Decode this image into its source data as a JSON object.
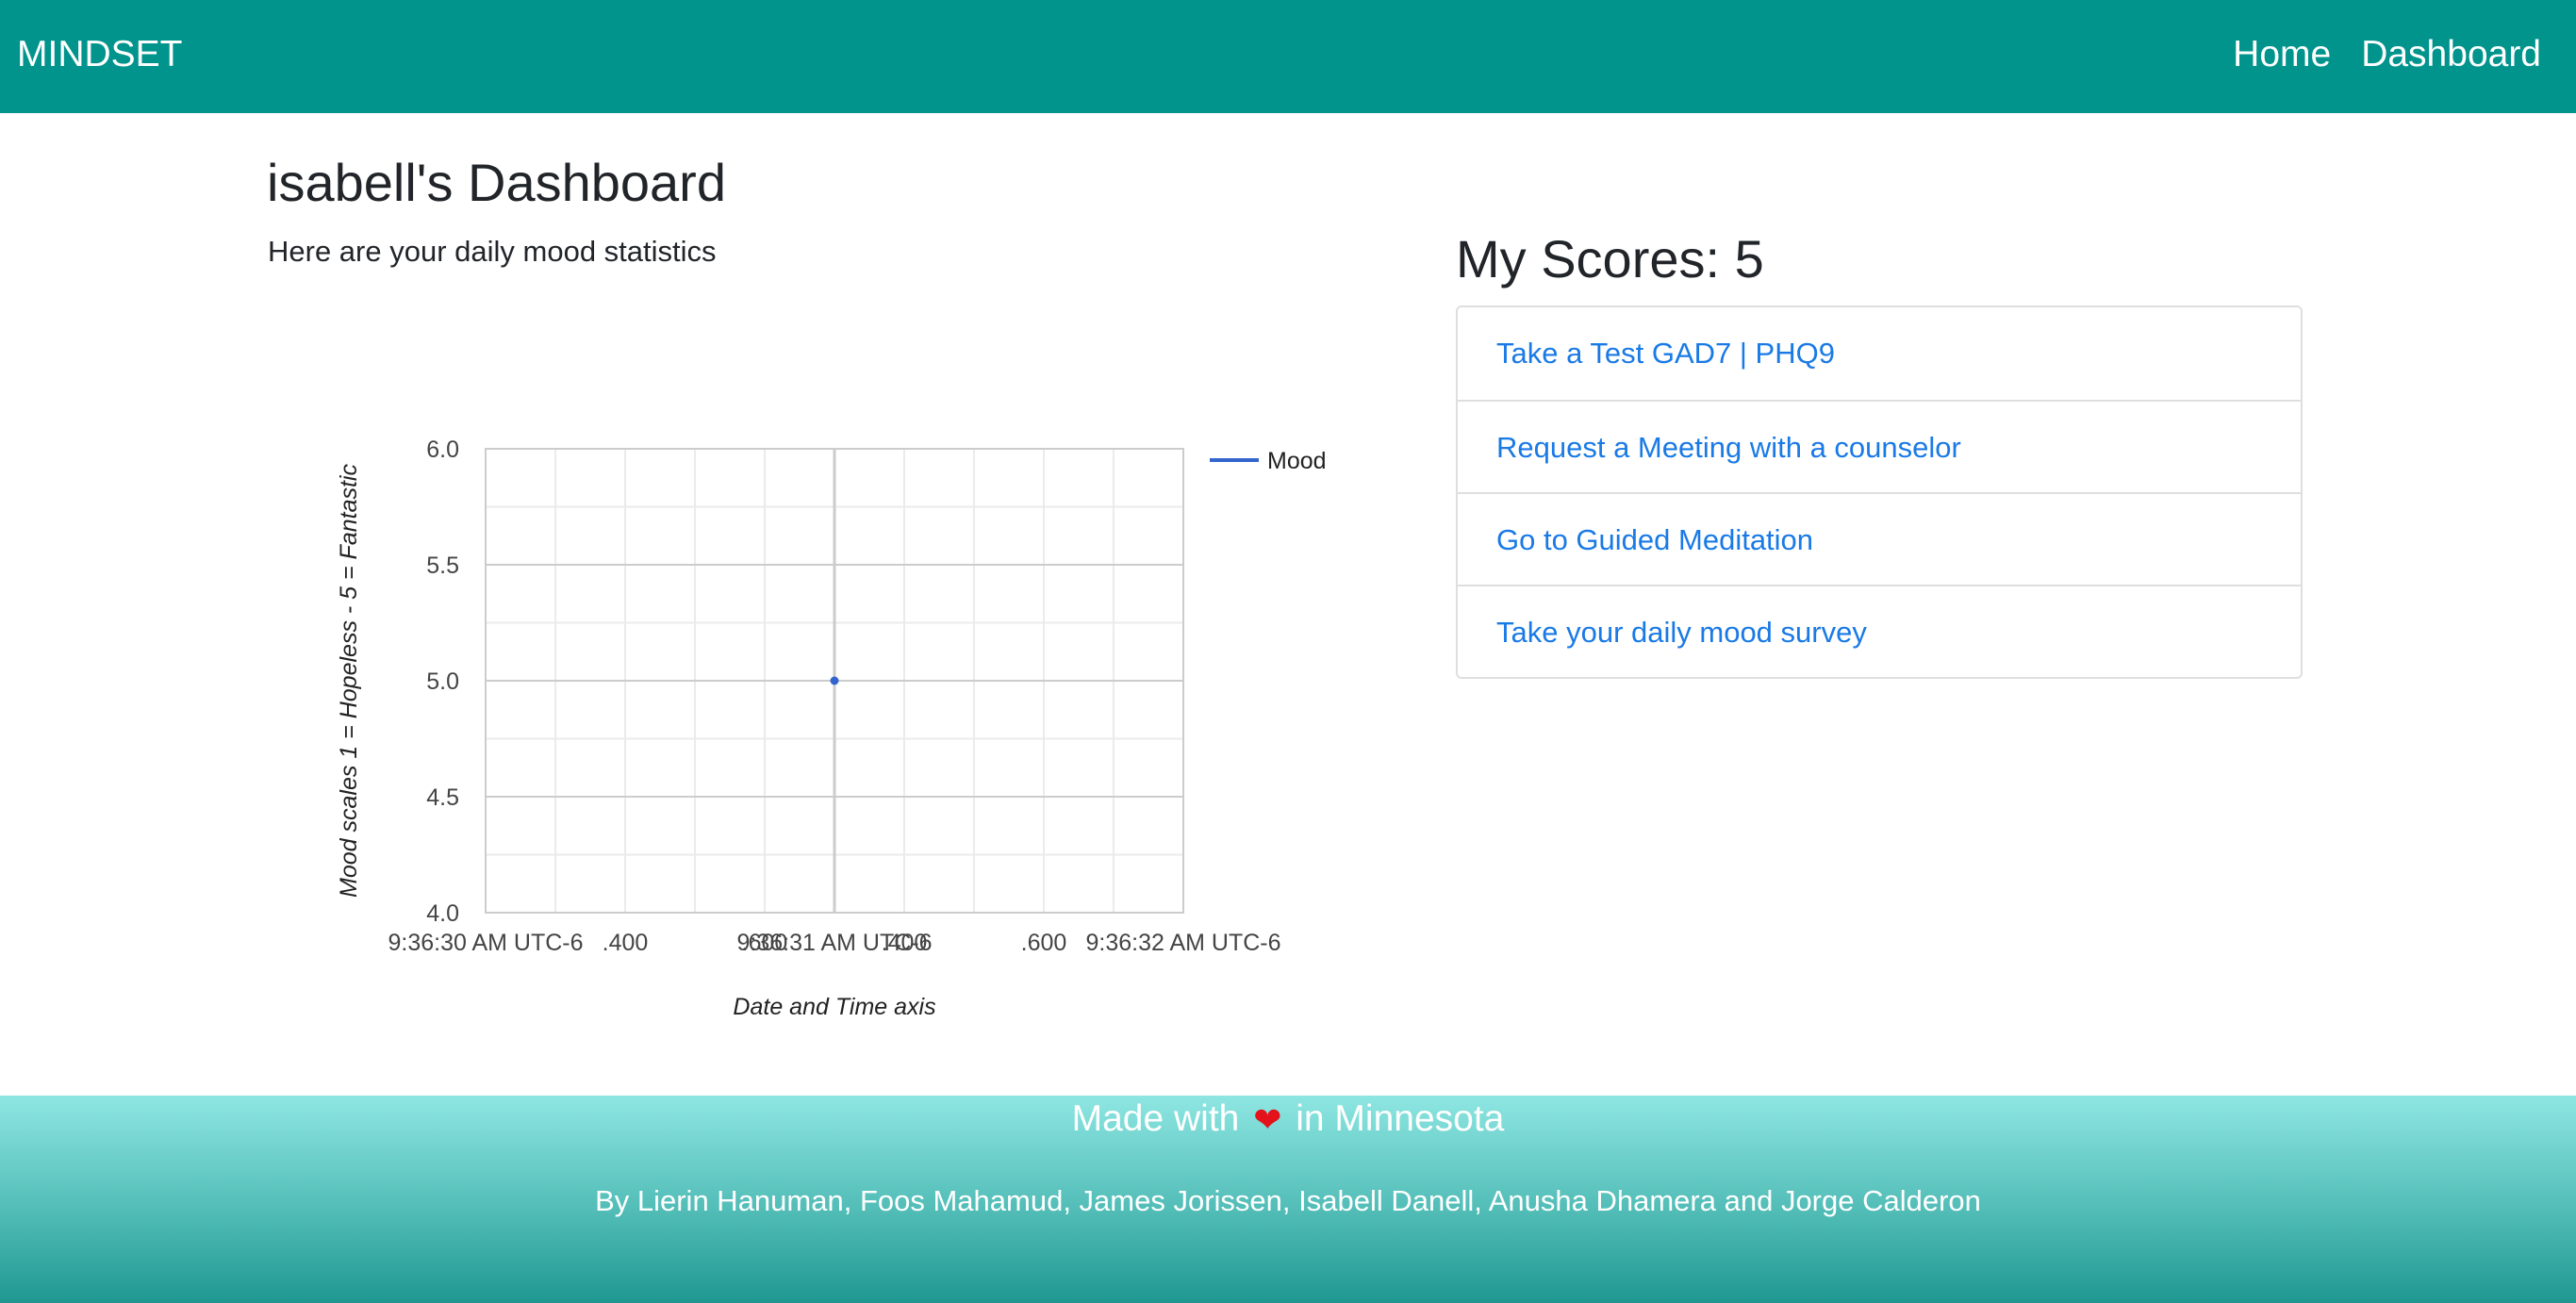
{
  "navbar": {
    "brand": "MINDSET",
    "links": [
      "Home",
      "Dashboard"
    ],
    "color": "#00948d"
  },
  "dashboard": {
    "title": "isabell's Dashboard",
    "subtitle": "Here are your daily mood statistics"
  },
  "scores": {
    "title": "My Scores: 5",
    "links": [
      "Take a Test GAD7 | PHQ9",
      "Request a Meeting with a counselor",
      "Go to Guided Meditation",
      "Take your daily mood survey"
    ],
    "link_color": "#1a7ae5"
  },
  "footer": {
    "made_prefix": "Made with",
    "heart_icon": "heart-icon",
    "made_suffix": "in Minnesota",
    "credits": "By Lierin Hanuman, Foos Mahamud, James Jorissen, Isabell Danell, Anusha Dhamera and Jorge Calderon"
  },
  "chart_data": {
    "type": "line",
    "series": [
      {
        "name": "Mood",
        "color": "#3366cc",
        "points": [
          {
            "x": "9:36:31 AM UTC-6",
            "y": 5
          }
        ]
      }
    ],
    "x_tick_labels": [
      "9:36:30 AM UTC-6",
      ".400",
      ".600",
      "9:36:31 AM UTC-6",
      ".400",
      ".600",
      "9:36:32 AM UTC-6"
    ],
    "y_tick_labels": [
      "6.0",
      "5.5",
      "5.0",
      "4.5",
      "4.0"
    ],
    "ylim": [
      4.0,
      6.0
    ],
    "xlabel": "Date and Time axis",
    "ylabel": "Mood scales 1 = Hopeless - 5 = Fantastic",
    "legend_position": "right",
    "grid": true
  }
}
